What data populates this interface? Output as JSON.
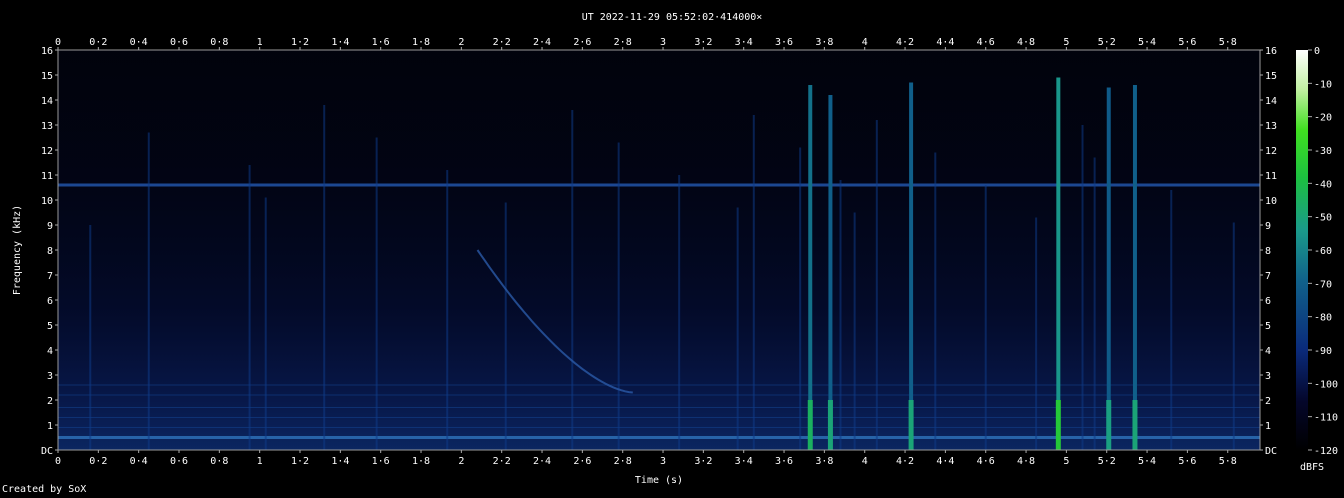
{
  "chart_data": {
    "type": "heatmap",
    "title": "UT 2022-11-29 05:52:02·414000×",
    "xlabel": "Time (s)",
    "ylabel": "Frequency (kHz)",
    "xlim": [
      0,
      5.96
    ],
    "ylim": [
      0,
      16
    ],
    "x_ticks": [
      "0",
      "0·2",
      "0·4",
      "0·6",
      "0·8",
      "1",
      "1·2",
      "1·4",
      "1·6",
      "1·8",
      "2",
      "2·2",
      "2·4",
      "2·6",
      "2·8",
      "3",
      "3·2",
      "3·4",
      "3·6",
      "3·8",
      "4",
      "4·2",
      "4·4",
      "4·6",
      "4·8",
      "5",
      "5·2",
      "5·4",
      "5·6",
      "5·8"
    ],
    "y_ticks": [
      "DC",
      "1",
      "2",
      "3",
      "4",
      "5",
      "6",
      "7",
      "8",
      "9",
      "10",
      "11",
      "12",
      "13",
      "14",
      "15",
      "16"
    ],
    "colorbar": {
      "label": "dBFS",
      "ticks": [
        "0",
        "-10",
        "-20",
        "-30",
        "-40",
        "-50",
        "-60",
        "-70",
        "-80",
        "-90",
        "-100",
        "-110",
        "-120"
      ],
      "range": [
        -120,
        0
      ]
    },
    "features": {
      "noise_floor_dbfs": -105,
      "hum_lines_khz": [
        0.5,
        10.6
      ],
      "strong_impulses": [
        {
          "t": 3.73,
          "top_khz": 14.6,
          "dbfs": -65
        },
        {
          "t": 3.83,
          "top_khz": 14.2,
          "dbfs": -70
        },
        {
          "t": 4.23,
          "top_khz": 14.7,
          "dbfs": -70
        },
        {
          "t": 4.96,
          "top_khz": 14.9,
          "dbfs": -55
        },
        {
          "t": 5.21,
          "top_khz": 14.5,
          "dbfs": -72
        },
        {
          "t": 5.34,
          "top_khz": 14.6,
          "dbfs": -70
        }
      ],
      "chirp": {
        "t_start": 2.08,
        "f_start_khz": 8.0,
        "t_end": 2.85,
        "f_end_khz": 2.3
      }
    },
    "colors": {
      "low": "#000000",
      "mid_low": "#0a2a7a",
      "mid": "#1a9a8a",
      "mid_high": "#22d020",
      "high": "#ffffff"
    }
  },
  "footer": {
    "credit": "Created by SoX"
  }
}
